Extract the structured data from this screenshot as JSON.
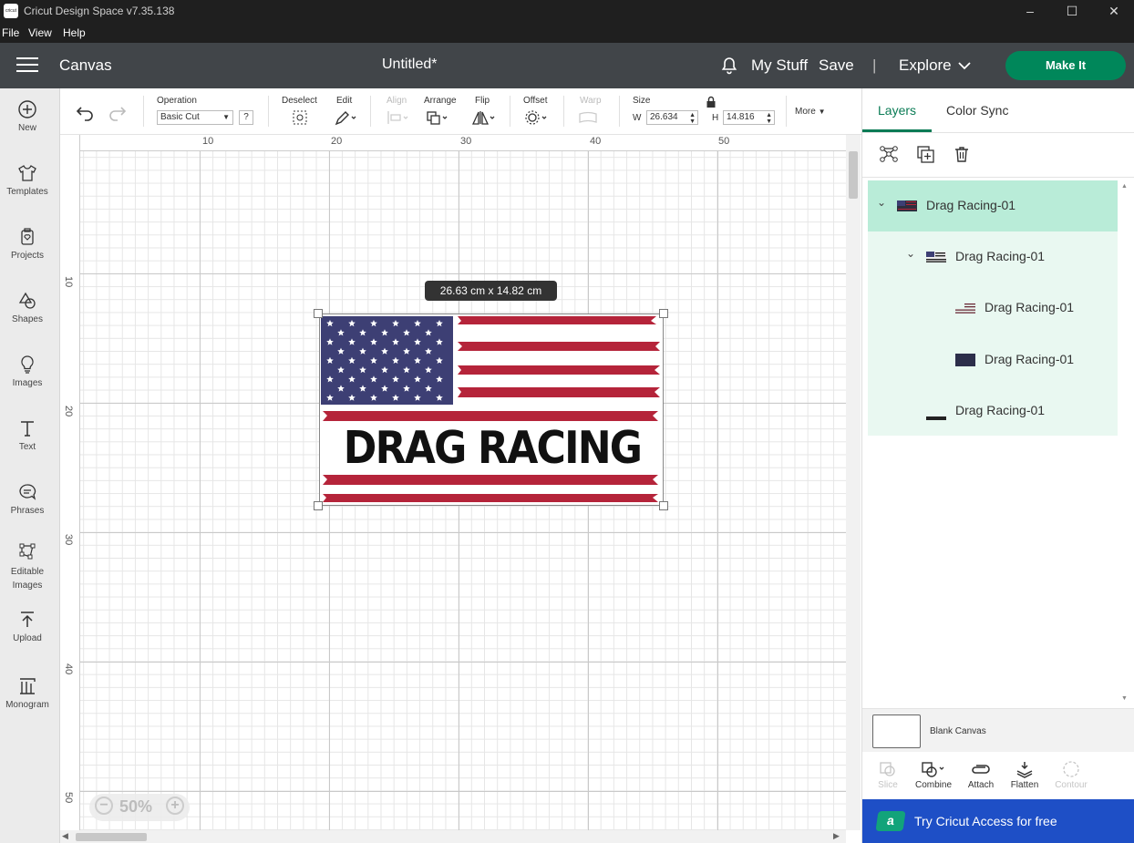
{
  "window": {
    "title": "Cricut Design Space  v7.35.138",
    "logo_text": "cricut"
  },
  "menu": [
    "File",
    "View",
    "Help"
  ],
  "header": {
    "section": "Canvas",
    "doc_title": "Untitled*",
    "my_stuff": "My Stuff",
    "save": "Save",
    "divider": "|",
    "explore": "Explore",
    "make_it": "Make It"
  },
  "sidebar": [
    {
      "label": "New",
      "icon": "plus-circle-icon"
    },
    {
      "label": "Templates",
      "icon": "shirt-icon"
    },
    {
      "label": "Projects",
      "icon": "projects-icon"
    },
    {
      "label": "Shapes",
      "icon": "shapes-icon"
    },
    {
      "label": "Images",
      "icon": "lightbulb-icon"
    },
    {
      "label": "Text",
      "icon": "text-icon"
    },
    {
      "label": "Phrases",
      "icon": "speech-bubble-icon"
    },
    {
      "label": "Editable Images",
      "icon": "editable-images-icon"
    },
    {
      "label": "Upload",
      "icon": "upload-icon"
    },
    {
      "label": "Monogram",
      "icon": "monogram-icon"
    }
  ],
  "toolbar": {
    "operation_label": "Operation",
    "operation_value": "Basic Cut",
    "operation_help": "?",
    "deselect": "Deselect",
    "edit": "Edit",
    "align": "Align",
    "arrange": "Arrange",
    "flip": "Flip",
    "offset": "Offset",
    "warp": "Warp",
    "size": "Size",
    "w_label": "W",
    "w_value": "26.634",
    "h_label": "H",
    "h_value": "14.816",
    "more": "More"
  },
  "ruler": {
    "top": [
      "10",
      "20",
      "30",
      "40",
      "50"
    ],
    "left": [
      "10",
      "20",
      "30",
      "40",
      "50"
    ]
  },
  "canvas": {
    "size_tooltip": "26.63  cm x 14.82  cm",
    "design_text": "DRAG RACING",
    "zoom": "50%",
    "zoom_minus": "−",
    "zoom_plus": "+"
  },
  "panel": {
    "tabs": [
      "Layers",
      "Color Sync"
    ],
    "layers": [
      {
        "name": "Drag Racing-01",
        "level": 0,
        "expanded": true,
        "selected": true
      },
      {
        "name": "Drag Racing-01",
        "level": 1,
        "expanded": true
      },
      {
        "name": "Drag Racing-01",
        "level": 2
      },
      {
        "name": "Drag Racing-01",
        "level": 2
      },
      {
        "name": "Drag Racing-01",
        "level": 1
      }
    ],
    "blank_canvas": "Blank Canvas",
    "bottom_tools": [
      {
        "label": "Slice",
        "enabled": false
      },
      {
        "label": "Combine",
        "enabled": true
      },
      {
        "label": "Attach",
        "enabled": true
      },
      {
        "label": "Flatten",
        "enabled": true
      },
      {
        "label": "Contour",
        "enabled": false
      }
    ],
    "promo": "Try Cricut Access for free",
    "promo_badge": "a"
  },
  "colors": {
    "make_it": "#00875a",
    "header": "#414549",
    "selected_layer": "#b9ecd8",
    "promo": "#1e4fc6",
    "flag_blue": "#3d3f74",
    "flag_red": "#b5243a"
  }
}
